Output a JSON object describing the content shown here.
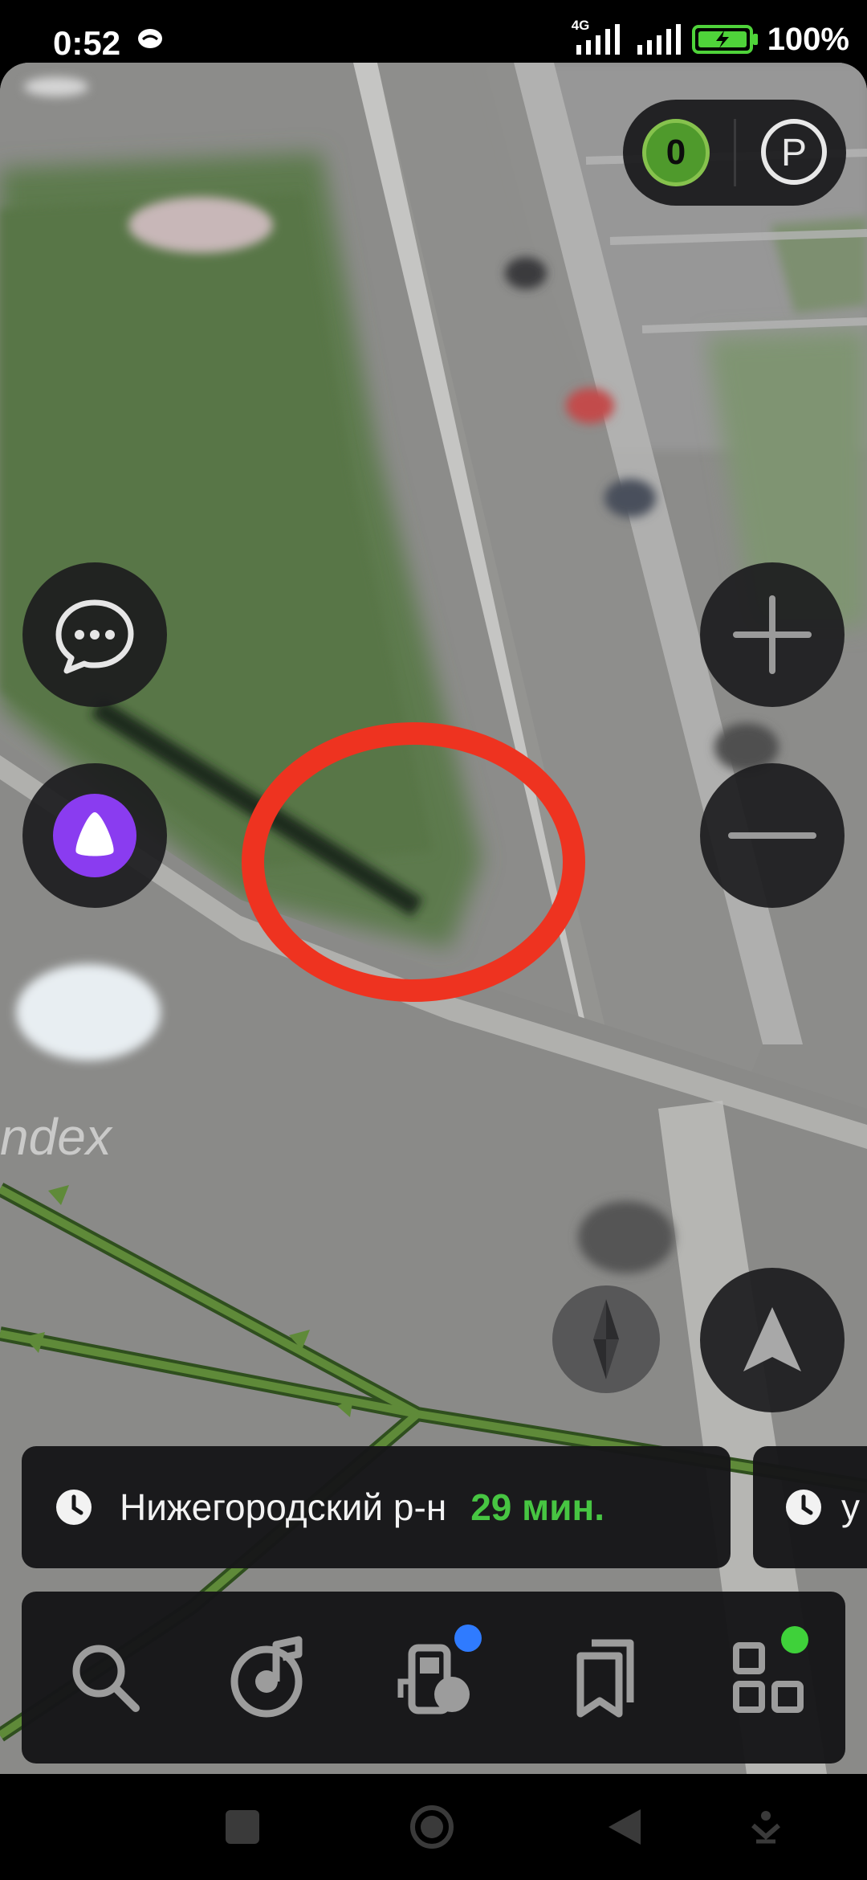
{
  "status_bar": {
    "time": "0:52",
    "network": "4G",
    "battery_percent": "100%",
    "battery_level": 1.0
  },
  "map": {
    "watermark": "ndex",
    "speed_limit_value": "0",
    "parking_icon": "parking-icon"
  },
  "controls": {
    "left": [
      "chat-icon",
      "alice-assistant-icon"
    ],
    "right": [
      "zoom-in-icon",
      "zoom-out-icon",
      "compass-icon",
      "location-arrow-icon"
    ]
  },
  "destinations": [
    {
      "name": "Нижегородский р-н",
      "time": "29 мин."
    },
    {
      "name": "у",
      "time": ""
    }
  ],
  "bottom_nav": {
    "items": [
      "search-icon",
      "music-icon",
      "gas-station-icon",
      "bookmarks-icon",
      "services-icon"
    ],
    "badges": {
      "gas_station": "#2f7bff",
      "services": "#3fd13a"
    }
  },
  "colors": {
    "accent_green": "#47c542",
    "marker_red": "#ee3320",
    "alice_purple": "#8a3cf0"
  }
}
